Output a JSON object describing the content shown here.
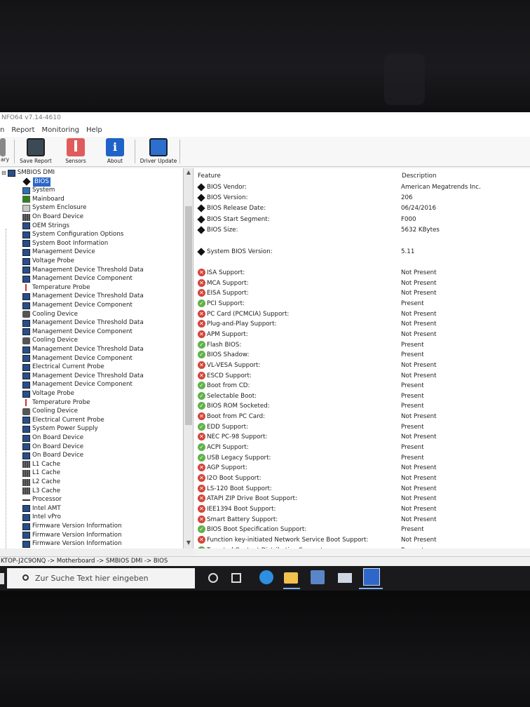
{
  "app": {
    "title": "NFO64 v7.14-4610"
  },
  "menu": [
    "n",
    "Report",
    "Monitoring",
    "Help"
  ],
  "toolbar": [
    {
      "label": "ary",
      "icon": "summary-icon"
    },
    {
      "label": "Save Report",
      "icon": "save-icon"
    },
    {
      "label": "Sensors",
      "icon": "thermometer-icon"
    },
    {
      "label": "About",
      "icon": "info-icon"
    },
    {
      "label": "Driver Update",
      "icon": "driver-update-icon"
    }
  ],
  "tree": {
    "root": "SMBIOS DMI",
    "items": [
      {
        "label": "BIOS",
        "icon": "diamond-icon",
        "selected": true
      },
      {
        "label": "System",
        "icon": "monitor-icon"
      },
      {
        "label": "Mainboard",
        "icon": "mainboard-icon"
      },
      {
        "label": "System Enclosure",
        "icon": "enclosure-icon"
      },
      {
        "label": "On Board Device",
        "icon": "device-icon"
      },
      {
        "label": "OEM Strings",
        "icon": "smbios-icon"
      },
      {
        "label": "System Configuration Options",
        "icon": "smbios-icon"
      },
      {
        "label": "System Boot Information",
        "icon": "smbios-icon"
      },
      {
        "label": "Management Device",
        "icon": "smbios-icon"
      },
      {
        "label": "Voltage Probe",
        "icon": "smbios-icon"
      },
      {
        "label": "Management Device Threshold Data",
        "icon": "smbios-icon"
      },
      {
        "label": "Management Device Component",
        "icon": "smbios-icon"
      },
      {
        "label": "Temperature Probe",
        "icon": "thermometer-icon"
      },
      {
        "label": "Management Device Threshold Data",
        "icon": "smbios-icon"
      },
      {
        "label": "Management Device Component",
        "icon": "smbios-icon"
      },
      {
        "label": "Cooling Device",
        "icon": "fan-icon"
      },
      {
        "label": "Management Device Threshold Data",
        "icon": "smbios-icon"
      },
      {
        "label": "Management Device Component",
        "icon": "smbios-icon"
      },
      {
        "label": "Cooling Device",
        "icon": "fan-icon"
      },
      {
        "label": "Management Device Threshold Data",
        "icon": "smbios-icon"
      },
      {
        "label": "Management Device Component",
        "icon": "smbios-icon"
      },
      {
        "label": "Electrical Current Probe",
        "icon": "smbios-icon"
      },
      {
        "label": "Management Device Threshold Data",
        "icon": "smbios-icon"
      },
      {
        "label": "Management Device Component",
        "icon": "smbios-icon"
      },
      {
        "label": "Voltage Probe",
        "icon": "smbios-icon"
      },
      {
        "label": "Temperature Probe",
        "icon": "thermometer-icon"
      },
      {
        "label": "Cooling Device",
        "icon": "fan-icon"
      },
      {
        "label": "Electrical Current Probe",
        "icon": "smbios-icon"
      },
      {
        "label": "System Power Supply",
        "icon": "smbios-icon"
      },
      {
        "label": "On Board Device",
        "icon": "smbios-icon"
      },
      {
        "label": "On Board Device",
        "icon": "smbios-icon"
      },
      {
        "label": "On Board Device",
        "icon": "smbios-icon"
      },
      {
        "label": "L1 Cache",
        "icon": "chip-icon"
      },
      {
        "label": "L1 Cache",
        "icon": "chip-icon"
      },
      {
        "label": "L2 Cache",
        "icon": "chip-icon"
      },
      {
        "label": "L3 Cache",
        "icon": "chip-icon"
      },
      {
        "label": "Processor",
        "icon": "processor-icon"
      },
      {
        "label": "Intel AMT",
        "icon": "smbios-icon"
      },
      {
        "label": "Intel vPro",
        "icon": "smbios-icon"
      },
      {
        "label": "Firmware Version Information",
        "icon": "smbios-icon"
      },
      {
        "label": "Firmware Version Information",
        "icon": "smbios-icon"
      },
      {
        "label": "Firmware Version Information",
        "icon": "smbios-icon"
      }
    ]
  },
  "details": {
    "header_feature": "Feature",
    "header_description": "Description",
    "rows": [
      {
        "name": "BIOS Vendor:",
        "value": "American Megatrends Inc.",
        "status": "info"
      },
      {
        "name": "BIOS Version:",
        "value": "206",
        "status": "info"
      },
      {
        "name": "BIOS Release Date:",
        "value": "06/24/2016",
        "status": "info"
      },
      {
        "name": "BIOS Start Segment:",
        "value": "F000",
        "status": "info"
      },
      {
        "name": "BIOS Size:",
        "value": "5632 KBytes",
        "status": "info"
      },
      {
        "name": "System BIOS Version:",
        "value": "5.11",
        "status": "info"
      },
      {
        "name": "ISA Support:",
        "value": "Not Present",
        "status": "no"
      },
      {
        "name": "MCA Support:",
        "value": "Not Present",
        "status": "no"
      },
      {
        "name": "EISA Support:",
        "value": "Not Present",
        "status": "no"
      },
      {
        "name": "PCI Support:",
        "value": "Present",
        "status": "yes"
      },
      {
        "name": "PC Card (PCMCIA) Support:",
        "value": "Not Present",
        "status": "no"
      },
      {
        "name": "Plug-and-Play Support:",
        "value": "Not Present",
        "status": "no"
      },
      {
        "name": "APM Support:",
        "value": "Not Present",
        "status": "no"
      },
      {
        "name": "Flash BIOS:",
        "value": "Present",
        "status": "yes"
      },
      {
        "name": "BIOS Shadow:",
        "value": "Present",
        "status": "yes"
      },
      {
        "name": "VL-VESA Support:",
        "value": "Not Present",
        "status": "no"
      },
      {
        "name": "ESCD Support:",
        "value": "Not Present",
        "status": "no"
      },
      {
        "name": "Boot from CD:",
        "value": "Present",
        "status": "yes"
      },
      {
        "name": "Selectable Boot:",
        "value": "Present",
        "status": "yes"
      },
      {
        "name": "BIOS ROM Socketed:",
        "value": "Present",
        "status": "yes"
      },
      {
        "name": "Boot from PC Card:",
        "value": "Not Present",
        "status": "no"
      },
      {
        "name": "EDD Support:",
        "value": "Present",
        "status": "yes"
      },
      {
        "name": "NEC PC-98 Support:",
        "value": "Not Present",
        "status": "no"
      },
      {
        "name": "ACPI Support:",
        "value": "Present",
        "status": "yes"
      },
      {
        "name": "USB Legacy Support:",
        "value": "Present",
        "status": "yes"
      },
      {
        "name": "AGP Support:",
        "value": "Not Present",
        "status": "no"
      },
      {
        "name": "I2O Boot Support:",
        "value": "Not Present",
        "status": "no"
      },
      {
        "name": "LS-120 Boot Support:",
        "value": "Not Present",
        "status": "no"
      },
      {
        "name": "ATAPI ZIP Drive Boot Support:",
        "value": "Not Present",
        "status": "no"
      },
      {
        "name": "IEE1394 Boot Support:",
        "value": "Not Present",
        "status": "no"
      },
      {
        "name": "Smart Battery Support:",
        "value": "Not Present",
        "status": "no"
      },
      {
        "name": "BIOS Boot Specification Support:",
        "value": "Present",
        "status": "yes"
      },
      {
        "name": "Function key-initiated Network Service Boot Support:",
        "value": "Not Present",
        "status": "no"
      },
      {
        "name": "Targeted Content Distribution Support:",
        "value": "Present",
        "status": "yes"
      }
    ]
  },
  "status_bar": "KTOP-J2C9ONQ -> Motherboard -> SMBIOS DMI -> BIOS",
  "taskbar": {
    "search_placeholder": "Zur Suche Text hier eingeben"
  }
}
